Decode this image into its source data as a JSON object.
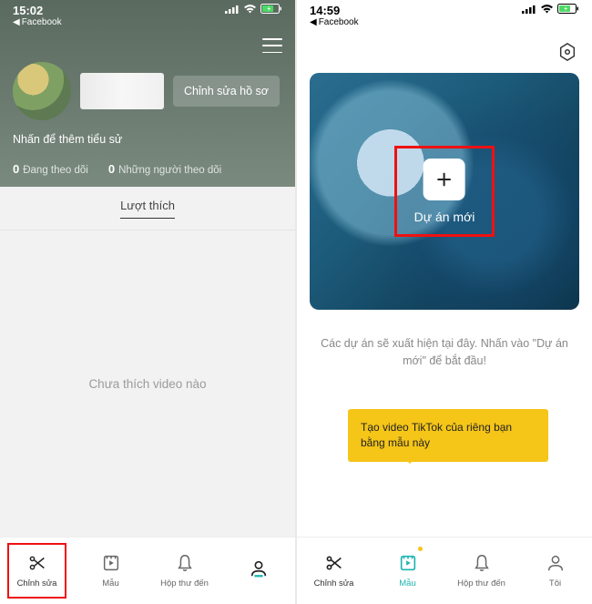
{
  "left": {
    "status": {
      "time": "15:02",
      "back": "Facebook"
    },
    "header": {
      "edit_button": "Chỉnh sửa hồ sơ",
      "bio_prompt": "Nhấn để thêm tiểu sử",
      "stats": {
        "following_num": "0",
        "following_label": "Đang theo dõi",
        "followers_num": "0",
        "followers_label": "Những người theo dõi"
      }
    },
    "tab": {
      "likes": "Lượt thích"
    },
    "empty": "Chưa thích video nào",
    "nav": {
      "edit": "Chỉnh sửa",
      "template": "Mẫu",
      "inbox": "Hộp thư đến",
      "me": ""
    }
  },
  "right": {
    "status": {
      "time": "14:59",
      "back": "Facebook"
    },
    "project": {
      "new_label": "Dự án mới",
      "hint": "Các dự án sẽ xuất hiện tại đây. Nhấn vào \"Dự án mới\" để bắt đầu!"
    },
    "tooltip": "Tạo video TikTok của riêng bạn bằng mẫu này",
    "nav": {
      "edit": "Chỉnh sửa",
      "template": "Mẫu",
      "inbox": "Hộp thư đến",
      "me": "Tôi"
    }
  }
}
